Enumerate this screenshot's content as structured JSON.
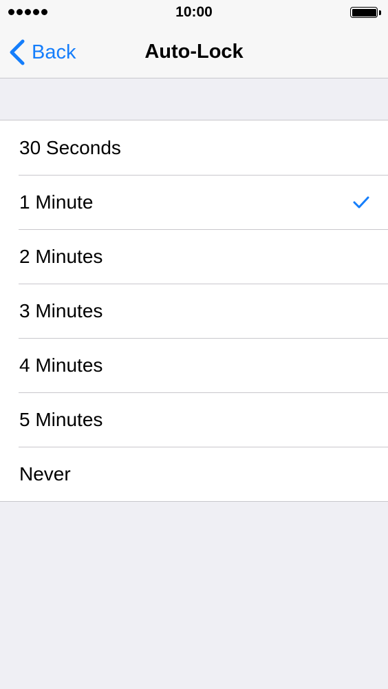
{
  "status_bar": {
    "signal_icon": "signal-dots-icon",
    "time": "10:00",
    "battery_icon": "battery-full-icon"
  },
  "nav": {
    "back_icon": "chevron-left-icon",
    "back_label": "Back",
    "title": "Auto-Lock"
  },
  "options": [
    {
      "label": "30 Seconds",
      "selected": false
    },
    {
      "label": "1 Minute",
      "selected": true
    },
    {
      "label": "2 Minutes",
      "selected": false
    },
    {
      "label": "3 Minutes",
      "selected": false
    },
    {
      "label": "4 Minutes",
      "selected": false
    },
    {
      "label": "5 Minutes",
      "selected": false
    },
    {
      "label": "Never",
      "selected": false
    }
  ],
  "colors": {
    "accent": "#157efb",
    "background": "#efeff4",
    "separator": "#c8c7cc",
    "bar": "#f7f7f7"
  }
}
